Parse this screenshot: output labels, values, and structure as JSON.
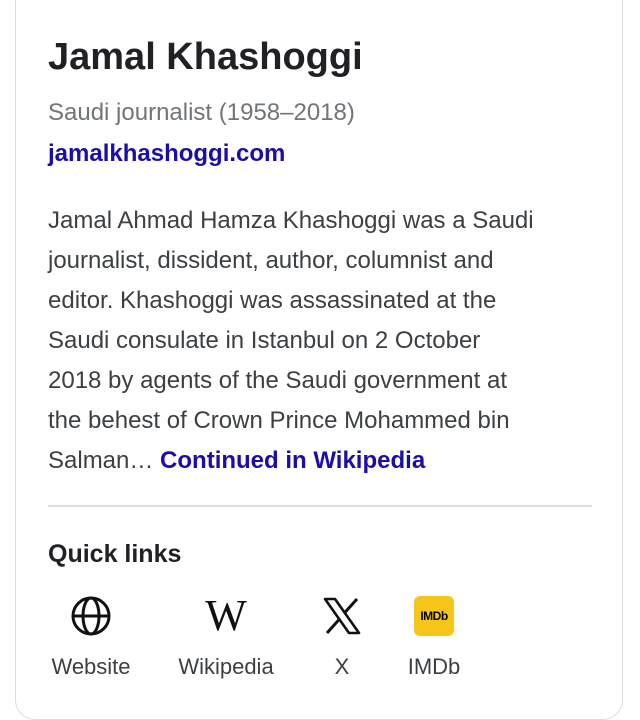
{
  "entity": {
    "name": "Jamal Khashoggi",
    "subtitle": "Saudi journalist (1958–2018)",
    "website": "jamalkhashoggi.com"
  },
  "description": {
    "lines": [
      "Jamal Ahmad Hamza Khashoggi was a Saudi",
      "journalist, dissident, author, columnist and",
      "editor. Khashoggi was assassinated at the",
      "Saudi consulate in Istanbul on 2 October",
      "2018 by agents of the Saudi government at",
      "the behest of Crown Prince Mohammed bin"
    ],
    "last_line_prefix": "Salman… ",
    "more_link": "Continued in Wikipedia"
  },
  "quick_links": {
    "heading": "Quick links",
    "items": [
      {
        "label": "Website",
        "icon": "globe-icon"
      },
      {
        "label": "Wikipedia",
        "icon": "wikipedia-icon",
        "glyph": "W"
      },
      {
        "label": "X",
        "icon": "x-logo-icon"
      },
      {
        "label": "IMDb",
        "icon": "imdb-icon",
        "badge_text": "IMDb"
      }
    ]
  },
  "colors": {
    "link": "#1a0dab",
    "text": "#202124",
    "secondary": "#70757a",
    "imdb_yellow": "#f5c518"
  }
}
